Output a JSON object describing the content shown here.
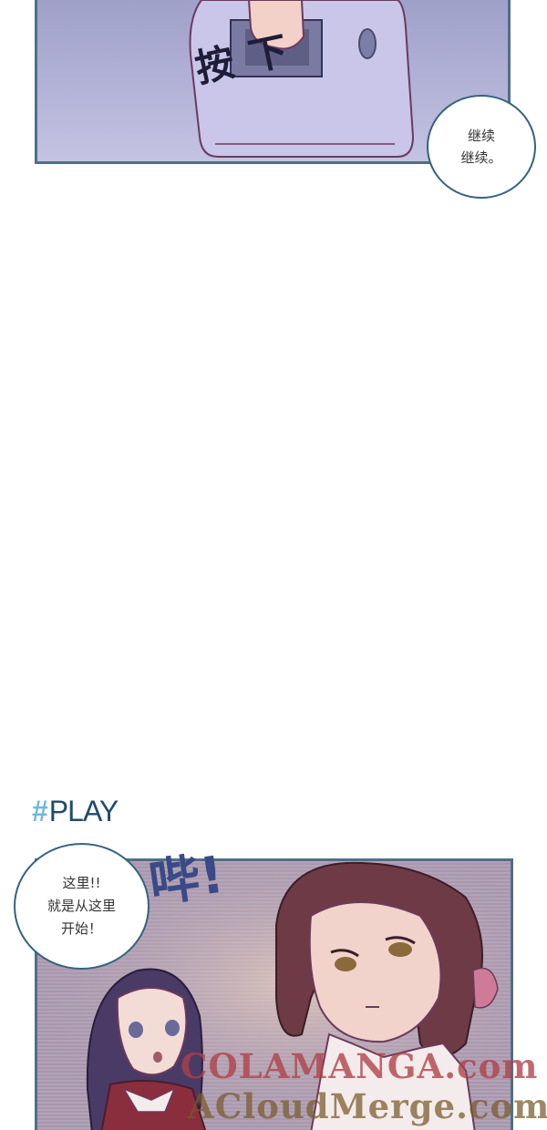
{
  "top_panel": {
    "sfx_press": "按下",
    "speech_bubble": "继续\n继续。"
  },
  "section_heading": {
    "hash": "#",
    "label": "PLAY"
  },
  "bottom_panel": {
    "speech_bubble": "这里!!\n就是从这里\n开始！",
    "sfx_beep": "哔!"
  },
  "watermark": {
    "line1": "COLAMANGA.com",
    "line2": "ACloudMerge.com"
  },
  "colors": {
    "panel_border": "#4f6f88",
    "bubble_border": "#35627f",
    "heading_text": "#1f4c6a",
    "heading_hash": "#6db7e3"
  }
}
